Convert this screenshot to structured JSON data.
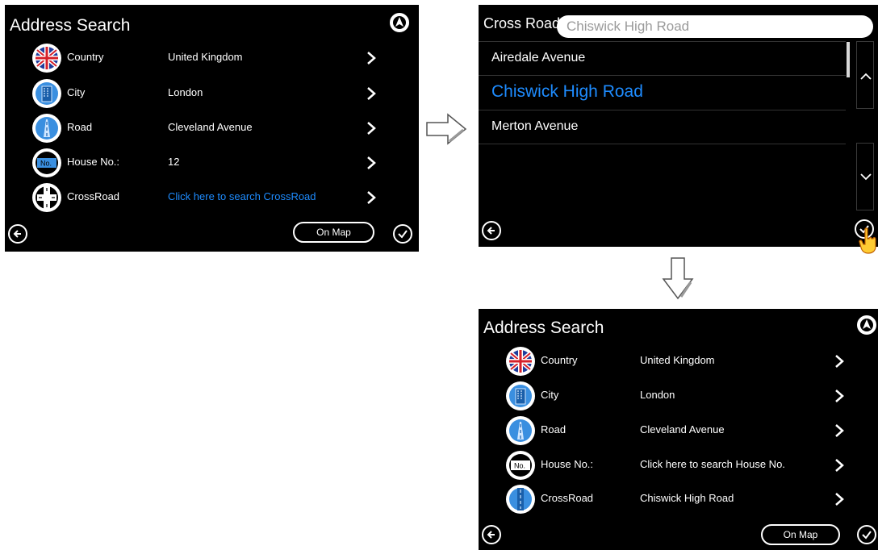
{
  "screen1": {
    "title": "Address Search",
    "rows": [
      {
        "label": "Country",
        "value": "United Kingdom",
        "icon": "uk-flag-icon",
        "link": false
      },
      {
        "label": "City",
        "value": "London",
        "icon": "city-building-icon",
        "link": false
      },
      {
        "label": "Road",
        "value": "Cleveland Avenue",
        "icon": "road-icon",
        "link": false
      },
      {
        "label": "House No.:",
        "value": "12",
        "icon": "house-number-icon",
        "link": false
      },
      {
        "label": "CrossRoad",
        "value": "Click here to search CrossRoad",
        "icon": "crossroad-icon",
        "link": true
      }
    ],
    "on_map": "On Map"
  },
  "screen2": {
    "title": "Cross Road",
    "search_value": "Chiswick High Road",
    "items": [
      "Airedale Avenue",
      "Chiswick High Road",
      "Merton Avenue"
    ],
    "selected_index": 1
  },
  "screen3": {
    "title": "Address Search",
    "rows": [
      {
        "label": "Country",
        "value": "United Kingdom",
        "icon": "uk-flag-icon",
        "link": false
      },
      {
        "label": "City",
        "value": "London",
        "icon": "city-building-icon",
        "link": false
      },
      {
        "label": "Road",
        "value": "Cleveland Avenue",
        "icon": "road-icon",
        "link": false
      },
      {
        "label": "House No.:",
        "value": "Click here to search House No.",
        "icon": "house-number-icon",
        "link": false
      },
      {
        "label": "CrossRoad",
        "value": "Chiswick High Road",
        "icon": "crossroad-icon",
        "link": false
      }
    ],
    "on_map": "On Map"
  },
  "colors": {
    "screen_bg": "#000000",
    "link_blue": "#1e8cff",
    "text_white": "#ffffff",
    "placeholder_gray": "#9a9a9a"
  },
  "house_icon_text": "No."
}
